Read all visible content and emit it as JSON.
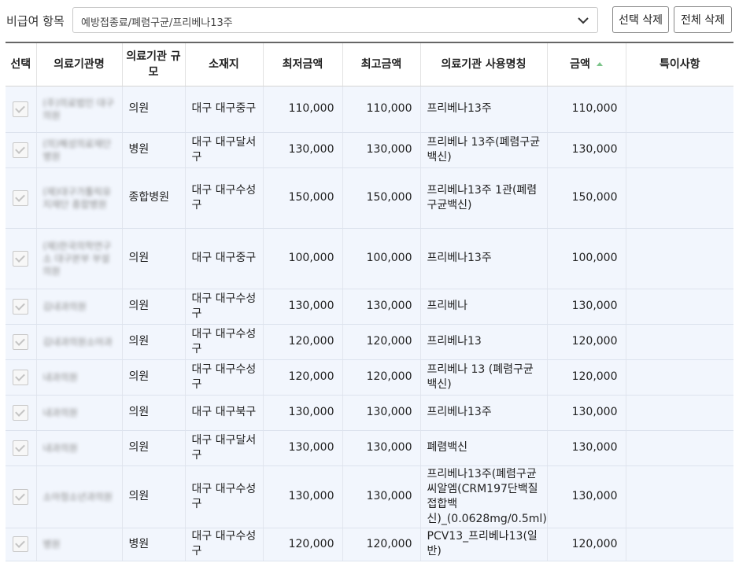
{
  "filter": {
    "label": "비급여 항목",
    "selected": "예방접종료/폐렴구균/프리베나13주",
    "delete_selected": "선택 삭제",
    "delete_all": "전체 삭제"
  },
  "table": {
    "headers": {
      "select": "선택",
      "name": "의료기관명",
      "scale": "의료기관 규모",
      "location": "소재지",
      "min": "최저금액",
      "max": "최고금액",
      "usage": "의료기관 사용명칭",
      "amount": "금액",
      "note": "특이사항"
    },
    "rows": [
      {
        "name": "(주)의료법인 대구의원",
        "scale": "의원",
        "location": "대구 대구중구",
        "min": "110,000",
        "max": "110,000",
        "usage": "프리베나13주",
        "amount": "110,000",
        "note": ""
      },
      {
        "name": "(의)혜성의료재단 병원",
        "scale": "병원",
        "location": "대구 대구달서구",
        "min": "130,000",
        "max": "130,000",
        "usage": "프리베나 13주(폐렴구균백신)",
        "amount": "130,000",
        "note": ""
      },
      {
        "name": "(재)대구가톨릭유지재단 종합병원",
        "scale": "종합병원",
        "location": "대구 대구수성구",
        "min": "150,000",
        "max": "150,000",
        "usage": "프리베나13주 1관(폐렴구균백신)",
        "amount": "150,000",
        "note": ""
      },
      {
        "name": "(재)한국의학연구소 대구본부 부설의원",
        "scale": "의원",
        "location": "대구 대구중구",
        "min": "100,000",
        "max": "100,000",
        "usage": "프리베나13주",
        "amount": "100,000",
        "note": ""
      },
      {
        "name": "김내과의원",
        "scale": "의원",
        "location": "대구 대구수성구",
        "min": "130,000",
        "max": "130,000",
        "usage": "프리베나",
        "amount": "130,000",
        "note": ""
      },
      {
        "name": "김내과의원소아과",
        "scale": "의원",
        "location": "대구 대구수성구",
        "min": "120,000",
        "max": "120,000",
        "usage": "프리베나13",
        "amount": "120,000",
        "note": ""
      },
      {
        "name": "내과의원",
        "scale": "의원",
        "location": "대구 대구수성구",
        "min": "120,000",
        "max": "120,000",
        "usage": "프리베나 13 (폐렴구균백신)",
        "amount": "120,000",
        "note": ""
      },
      {
        "name": "내과의원",
        "scale": "의원",
        "location": "대구 대구북구",
        "min": "130,000",
        "max": "130,000",
        "usage": "프리베나13주",
        "amount": "130,000",
        "note": ""
      },
      {
        "name": "내과의원",
        "scale": "의원",
        "location": "대구 대구달서구",
        "min": "130,000",
        "max": "130,000",
        "usage": "폐렴백신",
        "amount": "130,000",
        "note": ""
      },
      {
        "name": "소아청소년과의원",
        "scale": "의원",
        "location": "대구 대구수성구",
        "min": "130,000",
        "max": "130,000",
        "usage": "프리베나13주(폐렴구균씨알엠(CRM197단백질접합백신)_(0.0628mg/0.5ml)",
        "amount": "130,000",
        "note": ""
      },
      {
        "name": "병원",
        "scale": "병원",
        "location": "대구 대구수성구",
        "min": "120,000",
        "max": "120,000",
        "usage": "PCV13_프리베나13(일반)",
        "amount": "120,000",
        "note": ""
      }
    ]
  }
}
